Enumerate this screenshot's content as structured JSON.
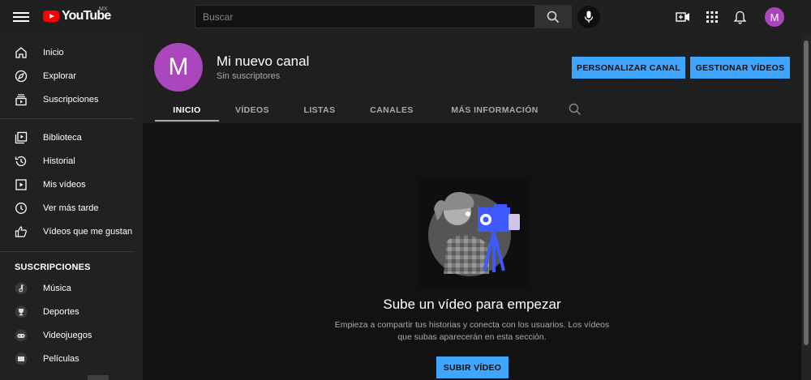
{
  "header": {
    "logo_text": "YouTube",
    "logo_region": "MX",
    "search_placeholder": "Buscar",
    "avatar_letter": "M",
    "brand_color": "#ff0000",
    "avatar_color": "#ab47bc"
  },
  "sidebar": {
    "main_items": [
      {
        "label": "Inicio",
        "icon": "home-icon"
      },
      {
        "label": "Explorar",
        "icon": "compass-icon"
      },
      {
        "label": "Suscripciones",
        "icon": "subscriptions-icon"
      }
    ],
    "library_items": [
      {
        "label": "Biblioteca",
        "icon": "library-icon"
      },
      {
        "label": "Historial",
        "icon": "history-icon"
      },
      {
        "label": "Mis vídeos",
        "icon": "my-videos-icon"
      },
      {
        "label": "Ver más tarde",
        "icon": "watch-later-icon"
      },
      {
        "label": "Vídeos que me gustan",
        "icon": "thumbs-up-icon"
      }
    ],
    "subscriptions_title": "SUSCRIPCIONES",
    "subscription_items": [
      {
        "label": "Música",
        "icon": "music-icon"
      },
      {
        "label": "Deportes",
        "icon": "trophy-icon"
      },
      {
        "label": "Videojuegos",
        "icon": "gamepad-icon"
      },
      {
        "label": "Películas",
        "icon": "film-icon"
      }
    ]
  },
  "channel": {
    "avatar_letter": "M",
    "name": "Mi nuevo canal",
    "subscribers": "Sin suscriptores",
    "customize_label": "PERSONALIZAR CANAL",
    "manage_label": "GESTIONAR VÍDEOS",
    "accent_color": "#3ea6ff",
    "tabs": [
      {
        "label": "INICIO",
        "active": true
      },
      {
        "label": "VÍDEOS",
        "active": false
      },
      {
        "label": "LISTAS",
        "active": false
      },
      {
        "label": "CANALES",
        "active": false
      },
      {
        "label": "MÁS INFORMACIÓN",
        "active": false
      }
    ]
  },
  "empty_state": {
    "title": "Sube un vídeo para empezar",
    "description_line1": "Empieza a compartir tus historias y conecta con los usuarios. Los vídeos",
    "description_line2": "que subas aparecerán en esta sección.",
    "upload_label": "SUBIR VÍDEO"
  }
}
